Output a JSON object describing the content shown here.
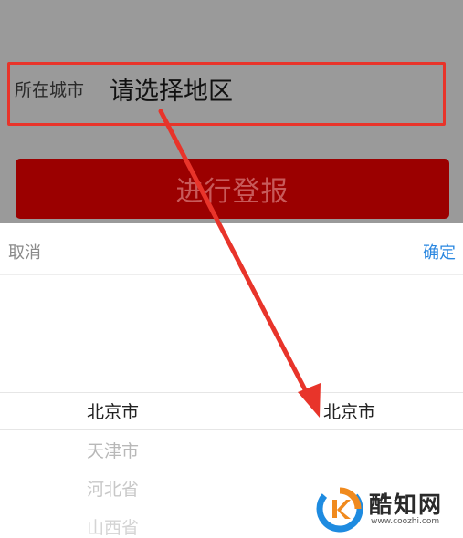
{
  "form": {
    "city_label": "所在城市",
    "city_value": "请选择地区",
    "submit_label": "进行登报"
  },
  "picker": {
    "cancel_label": "取消",
    "confirm_label": "确定",
    "province_options": [
      "北京市",
      "天津市",
      "河北省",
      "山西省"
    ],
    "city_options": [
      "北京市"
    ]
  },
  "watermark": {
    "name": "酷知网",
    "url": "www.coozhi.com"
  },
  "colors": {
    "accent_red": "#9b0000",
    "annotation_red": "#e8342a",
    "link_blue": "#2a87e0"
  }
}
